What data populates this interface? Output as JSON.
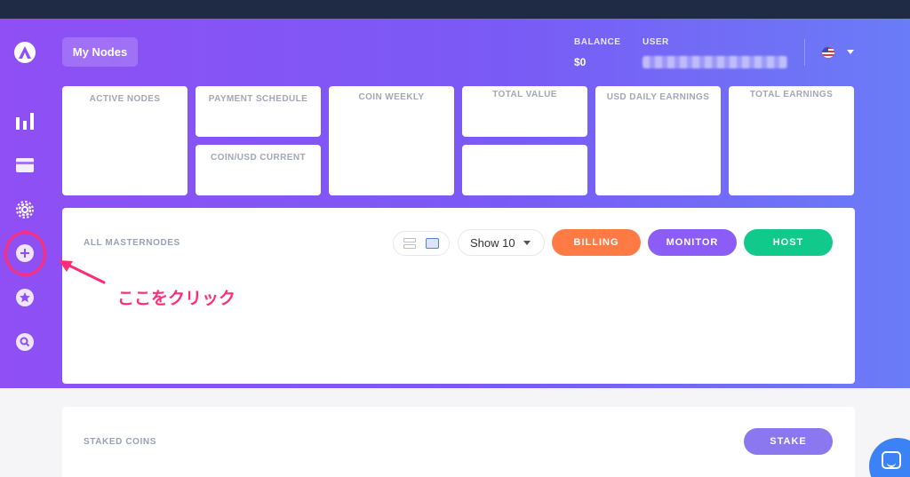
{
  "header": {
    "page_button": "My Nodes",
    "balance_label": "BALANCE",
    "balance_value": "$0",
    "user_label": "USER"
  },
  "sidebar": {
    "icons": [
      "logo-icon",
      "bar-chart-icon",
      "credit-card-icon",
      "gear-icon",
      "plus-circle-icon",
      "star-circle-icon",
      "search-circle-icon"
    ]
  },
  "stats": {
    "active_nodes": "ACTIVE NODES",
    "payment_schedule": "PAYMENT SCHEDULE",
    "coin_usd_current": "COIN/USD CURRENT",
    "coin_weekly": "COIN WEEKLY",
    "total_value": "TOTAL VALUE",
    "usd_daily_earnings": "USD DAILY EARNINGS",
    "total_earnings": "TOTAL EARNINGS"
  },
  "masternodes": {
    "title": "ALL MASTERNODES",
    "show_select": "Show 10",
    "billing": "BILLING",
    "monitor": "MONITOR",
    "host": "HOST"
  },
  "staked": {
    "title": "STAKED COINS",
    "stake": "STAKE"
  },
  "annotation": {
    "text": "ここをクリック",
    "color": "#ff2d78"
  },
  "colors": {
    "billing": "#ff7a45",
    "monitor": "#8b5cf6",
    "host": "#10c98a",
    "stake": "#8b78f0"
  }
}
